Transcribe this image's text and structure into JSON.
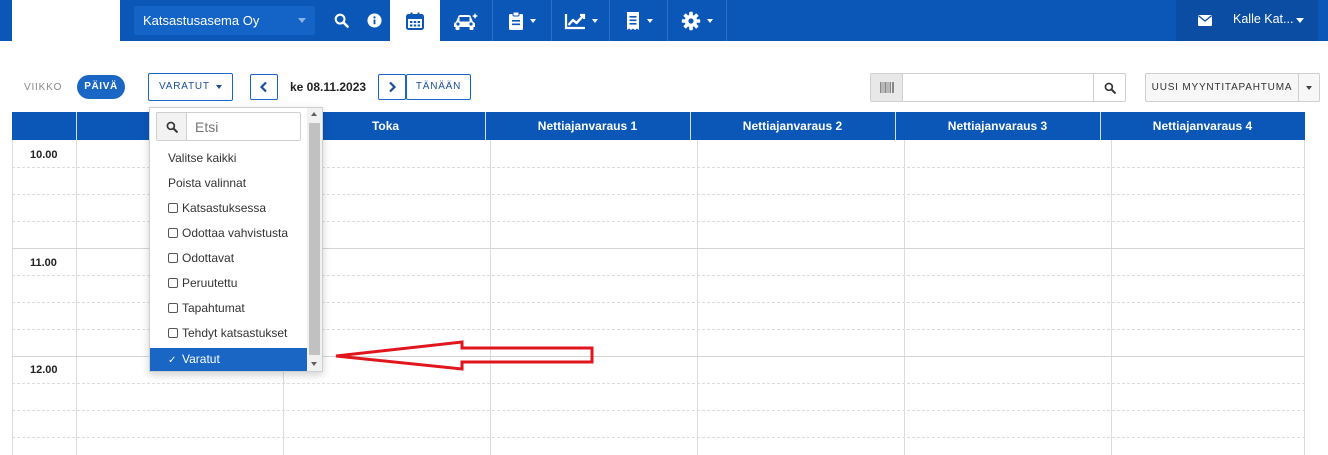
{
  "topbar": {
    "station": "Katsastusasema Oy",
    "user_name": "Kalle Kat...",
    "icons": [
      "search-icon",
      "info-icon",
      "calendar-icon",
      "car-icon",
      "clipboard-icon",
      "chart-icon",
      "receipt-icon",
      "gear-icon",
      "mail-icon"
    ],
    "accent": "#0b57b8"
  },
  "toolbar": {
    "view_week": "VIIKKO",
    "view_day": "PÄIVÄ",
    "filter_label": "VARATUT",
    "date": "ke 08.11.2023",
    "today": "TÄNÄÄN",
    "search_value": "",
    "new_sale": "UUSI MYYNTITAPAHTUMA"
  },
  "calendar": {
    "columns": [
      "",
      "Toka",
      "Nettiajanvaraus 1",
      "Nettiajanvaraus 2",
      "Nettiajanvaraus 3",
      "Nettiajanvaraus 4"
    ],
    "times": [
      "10.00",
      "11.00",
      "12.00"
    ]
  },
  "dropdown": {
    "search_placeholder": "Etsi",
    "select_all": "Valitse kaikki",
    "clear_all": "Poista valinnat",
    "options": [
      {
        "label": "Katsastuksessa",
        "checked": false
      },
      {
        "label": "Odottaa vahvistusta",
        "checked": false
      },
      {
        "label": "Odottavat",
        "checked": false
      },
      {
        "label": "Peruutettu",
        "checked": false
      },
      {
        "label": "Tapahtumat",
        "checked": false
      },
      {
        "label": "Tehdyt katsastukset",
        "checked": false
      },
      {
        "label": "Varatut",
        "checked": true
      }
    ],
    "check_mark": "✓"
  }
}
